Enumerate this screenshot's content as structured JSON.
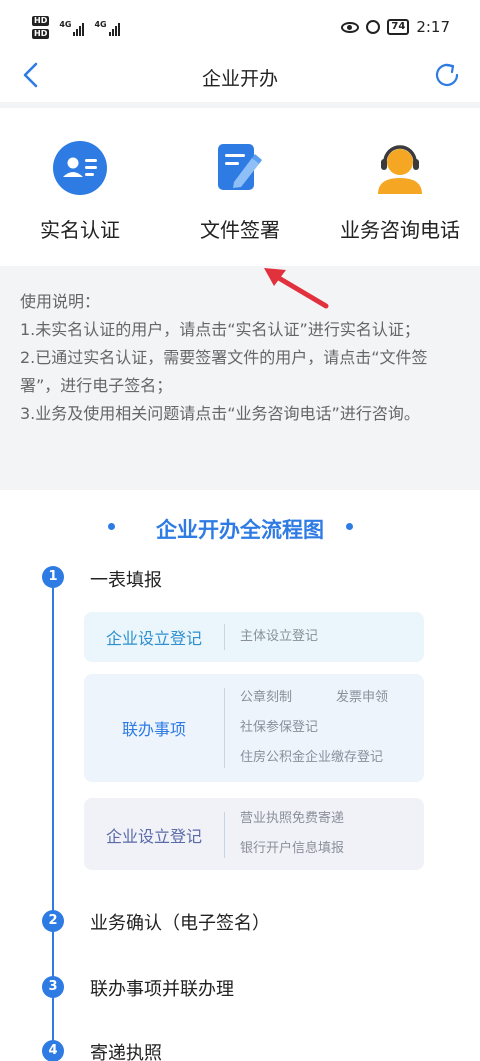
{
  "status": {
    "time": "2:17",
    "battery": "74",
    "hd": "HD",
    "net": "4G"
  },
  "nav": {
    "title": "企业开办"
  },
  "actions": [
    {
      "label": "实名认证",
      "icon": "id-card-icon"
    },
    {
      "label": "文件签署",
      "icon": "sign-document-icon"
    },
    {
      "label": "业务咨询电话",
      "icon": "customer-service-icon"
    }
  ],
  "instructions": {
    "heading": "使用说明：",
    "lines": [
      "1.未实名认证的用户，请点击“实名认证”进行实名认证；",
      "2.已通过实名认证，需要签署文件的用户，请点击“文件签署”，进行电子签名；",
      "3.业务及使用相关问题请点击“业务咨询电话”进行咨询。"
    ]
  },
  "flow": {
    "title": "企业开办全流程图",
    "steps": [
      {
        "num": "1",
        "label": "一表填报"
      },
      {
        "num": "2",
        "label": "业务确认（电子签名）"
      },
      {
        "num": "3",
        "label": "联办事项并联办理"
      },
      {
        "num": "4",
        "label": "寄递执照"
      }
    ],
    "box1": {
      "left": "企业设立登记",
      "items": [
        "主体设立登记"
      ]
    },
    "box2": {
      "left": "联办事项",
      "items": [
        "公章刻制",
        "发票申领",
        "社保参保登记",
        "住房公积金企业缴存登记"
      ]
    },
    "box3": {
      "left": "企业设立登记",
      "items": [
        "营业执照免费寄递",
        "银行开户信息填报"
      ]
    }
  },
  "colors": {
    "accent": "#2e7be4",
    "orange": "#f5a623",
    "arrow": "#e0313d"
  }
}
